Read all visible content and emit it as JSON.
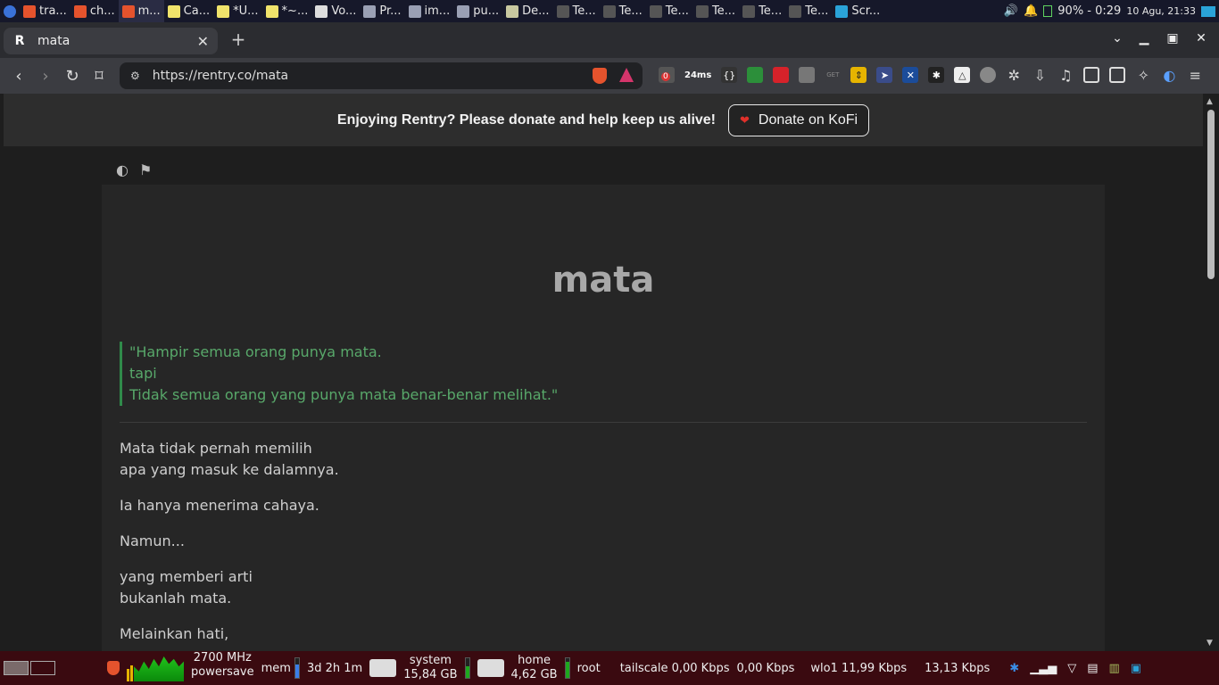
{
  "taskbar": {
    "tasks": [
      {
        "label": "tra...",
        "color": "#e5532d",
        "active": false
      },
      {
        "label": "ch...",
        "color": "#e5532d",
        "active": false
      },
      {
        "label": "m...",
        "color": "#e5532d",
        "active": true
      },
      {
        "label": "Ca...",
        "color": "#f0e36b",
        "active": false
      },
      {
        "label": "*U...",
        "color": "#f0e36b",
        "active": false
      },
      {
        "label": "*~...",
        "color": "#f0e36b",
        "active": false
      },
      {
        "label": "Vo...",
        "color": "#dddddd",
        "active": false
      },
      {
        "label": "Pr...",
        "color": "#9aa0b4",
        "active": false
      },
      {
        "label": "im...",
        "color": "#9aa0b4",
        "active": false
      },
      {
        "label": "pu...",
        "color": "#9aa0b4",
        "active": false
      },
      {
        "label": "De...",
        "color": "#c8c8a0",
        "active": false
      },
      {
        "label": "Te...",
        "color": "#555555",
        "active": false
      },
      {
        "label": "Te...",
        "color": "#555555",
        "active": false
      },
      {
        "label": "Te...",
        "color": "#555555",
        "active": false
      },
      {
        "label": "Te...",
        "color": "#555555",
        "active": false
      },
      {
        "label": "Te...",
        "color": "#555555",
        "active": false
      },
      {
        "label": "Te...",
        "color": "#555555",
        "active": false
      },
      {
        "label": "Scr...",
        "color": "#2aa3d8",
        "active": false
      }
    ],
    "battery": "90% - 0:29",
    "clock": "10 Agu, 21:33"
  },
  "browser": {
    "tab_title": "mata",
    "tab_favicon": "R",
    "url": "https://rentry.co/mata",
    "ext_badge": "0",
    "ext_timer": "24ms"
  },
  "banner": {
    "text": "Enjoying Rentry? Please donate and help keep us alive!",
    "donate_label": "Donate on KoFi"
  },
  "article": {
    "title": "mata",
    "quote_lines": [
      "\"Hampir semua orang punya mata.",
      "tapi",
      "Tidak semua orang yang punya mata benar-benar melihat.\""
    ],
    "paragraphs": [
      [
        "Mata tidak pernah memilih",
        "apa yang masuk ke dalamnya."
      ],
      [
        "Ia hanya menerima cahaya."
      ],
      [
        "Namun..."
      ],
      [
        "yang memberi arti",
        "bukanlah mata."
      ],
      [
        "Melainkan hati,"
      ]
    ]
  },
  "bottom_panel": {
    "cpu_freq": "2700 MHz",
    "cpu_governor": "powersave",
    "mem_label": "mem",
    "uptime": "3d 2h 1m",
    "disk_system_label": "system",
    "disk_system_size": "15,84 GB",
    "disk_home_label": "home",
    "disk_home_size": "4,62 GB",
    "root_label": "root",
    "tailscale": "tailscale 0,00 Kbps",
    "tailscale_up": "0,00 Kbps",
    "wlo1": "wlo1  11,99 Kbps",
    "wlo1_up": "13,13 Kbps"
  }
}
